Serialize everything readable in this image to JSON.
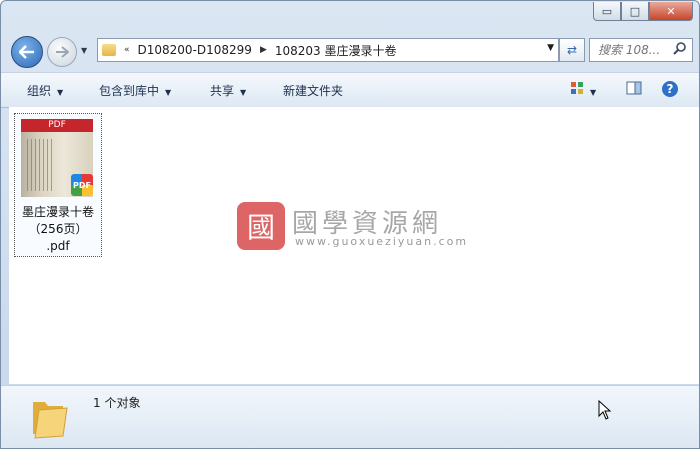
{
  "window": {
    "caption_buttons": {
      "minimize": "▭",
      "maximize": "□",
      "close": "✕"
    }
  },
  "nav": {
    "breadcrumb": {
      "overflow": "«",
      "segments": [
        "D108200-D108299",
        "108203 墨庄漫录十卷"
      ]
    },
    "search_placeholder": "搜索 108...",
    "icons": {
      "back": "back-arrow-icon",
      "forward": "forward-arrow-icon",
      "refresh": "refresh-icon",
      "search": "search-icon"
    }
  },
  "toolbar": {
    "organize": "组织",
    "include_in_library": "包含到库中",
    "share": "共享",
    "new_folder": "新建文件夹",
    "right_icons": [
      "view-options-icon",
      "preview-pane-icon",
      "help-icon"
    ]
  },
  "files": [
    {
      "name_line1": "墨庄漫录十卷",
      "name_line2": "（256页）",
      "name_line3": ".pdf",
      "thumb_header": "PDF",
      "badge": "PDF"
    }
  ],
  "watermark": {
    "title": "國學資源網",
    "url": "www.guoxueziyuan.com",
    "seal": "國"
  },
  "status": {
    "count": "1 个对象"
  },
  "colors": {
    "accent": "#2b68b5",
    "pdf_red": "#c4262b",
    "toolbar_text": "#1e3050"
  }
}
